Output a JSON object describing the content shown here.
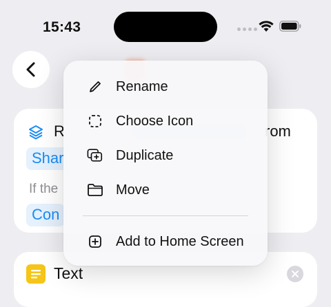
{
  "status_bar": {
    "time": "15:43"
  },
  "icons": {
    "back": "chevron-left-icon",
    "rename": "pencil-icon",
    "choose_icon": "dashed-square-icon",
    "duplicate": "duplicate-icon",
    "move": "folder-icon",
    "add_home": "plus-square-icon"
  },
  "colors": {
    "accent": "#1a8cf3",
    "token_bg": "#e5f1fd",
    "text_action": "#f5c518"
  },
  "background": {
    "card_title_start": "R",
    "card_title_end": "rom",
    "token_share": "Shar",
    "if_label": "If the",
    "token_cont": "Con",
    "text_action_label": "Text"
  },
  "menu": {
    "items": [
      {
        "label": "Rename"
      },
      {
        "label": "Choose Icon"
      },
      {
        "label": "Duplicate"
      },
      {
        "label": "Move"
      }
    ],
    "footer_item": {
      "label": "Add to Home Screen"
    }
  }
}
